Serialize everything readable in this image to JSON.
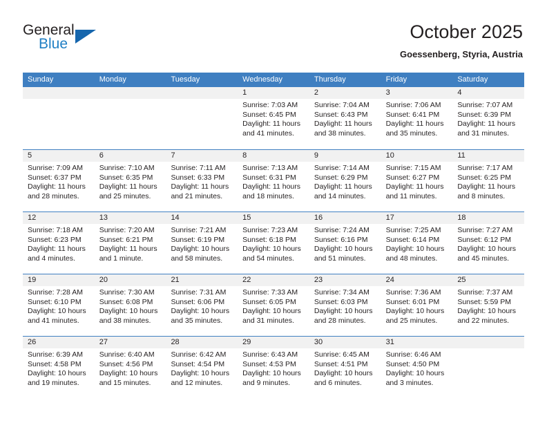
{
  "logo": {
    "primary_text": "General",
    "secondary_text": "Blue",
    "primary_color": "#231f20",
    "secondary_color": "#1f7fc4",
    "triangle_color": "#1666ad"
  },
  "header": {
    "title": "October 2025",
    "subtitle": "Goessenberg, Styria, Austria"
  },
  "theme": {
    "header_row_bg": "#3f7fc1",
    "header_row_text": "#ffffff",
    "date_band_bg": "#f1f1f1",
    "grid_line": "#3f7fc1",
    "body_text": "#231f20"
  },
  "weekdays": [
    "Sunday",
    "Monday",
    "Tuesday",
    "Wednesday",
    "Thursday",
    "Friday",
    "Saturday"
  ],
  "weeks": [
    [
      {
        "day": "",
        "sunrise": "",
        "sunset": "",
        "daylight_a": "",
        "daylight_b": "",
        "empty": true
      },
      {
        "day": "",
        "sunrise": "",
        "sunset": "",
        "daylight_a": "",
        "daylight_b": "",
        "empty": true
      },
      {
        "day": "",
        "sunrise": "",
        "sunset": "",
        "daylight_a": "",
        "daylight_b": "",
        "empty": true
      },
      {
        "day": "1",
        "sunrise": "Sunrise: 7:03 AM",
        "sunset": "Sunset: 6:45 PM",
        "daylight_a": "Daylight: 11 hours",
        "daylight_b": "and 41 minutes."
      },
      {
        "day": "2",
        "sunrise": "Sunrise: 7:04 AM",
        "sunset": "Sunset: 6:43 PM",
        "daylight_a": "Daylight: 11 hours",
        "daylight_b": "and 38 minutes."
      },
      {
        "day": "3",
        "sunrise": "Sunrise: 7:06 AM",
        "sunset": "Sunset: 6:41 PM",
        "daylight_a": "Daylight: 11 hours",
        "daylight_b": "and 35 minutes."
      },
      {
        "day": "4",
        "sunrise": "Sunrise: 7:07 AM",
        "sunset": "Sunset: 6:39 PM",
        "daylight_a": "Daylight: 11 hours",
        "daylight_b": "and 31 minutes."
      }
    ],
    [
      {
        "day": "5",
        "sunrise": "Sunrise: 7:09 AM",
        "sunset": "Sunset: 6:37 PM",
        "daylight_a": "Daylight: 11 hours",
        "daylight_b": "and 28 minutes."
      },
      {
        "day": "6",
        "sunrise": "Sunrise: 7:10 AM",
        "sunset": "Sunset: 6:35 PM",
        "daylight_a": "Daylight: 11 hours",
        "daylight_b": "and 25 minutes."
      },
      {
        "day": "7",
        "sunrise": "Sunrise: 7:11 AM",
        "sunset": "Sunset: 6:33 PM",
        "daylight_a": "Daylight: 11 hours",
        "daylight_b": "and 21 minutes."
      },
      {
        "day": "8",
        "sunrise": "Sunrise: 7:13 AM",
        "sunset": "Sunset: 6:31 PM",
        "daylight_a": "Daylight: 11 hours",
        "daylight_b": "and 18 minutes."
      },
      {
        "day": "9",
        "sunrise": "Sunrise: 7:14 AM",
        "sunset": "Sunset: 6:29 PM",
        "daylight_a": "Daylight: 11 hours",
        "daylight_b": "and 14 minutes."
      },
      {
        "day": "10",
        "sunrise": "Sunrise: 7:15 AM",
        "sunset": "Sunset: 6:27 PM",
        "daylight_a": "Daylight: 11 hours",
        "daylight_b": "and 11 minutes."
      },
      {
        "day": "11",
        "sunrise": "Sunrise: 7:17 AM",
        "sunset": "Sunset: 6:25 PM",
        "daylight_a": "Daylight: 11 hours",
        "daylight_b": "and 8 minutes."
      }
    ],
    [
      {
        "day": "12",
        "sunrise": "Sunrise: 7:18 AM",
        "sunset": "Sunset: 6:23 PM",
        "daylight_a": "Daylight: 11 hours",
        "daylight_b": "and 4 minutes."
      },
      {
        "day": "13",
        "sunrise": "Sunrise: 7:20 AM",
        "sunset": "Sunset: 6:21 PM",
        "daylight_a": "Daylight: 11 hours",
        "daylight_b": "and 1 minute."
      },
      {
        "day": "14",
        "sunrise": "Sunrise: 7:21 AM",
        "sunset": "Sunset: 6:19 PM",
        "daylight_a": "Daylight: 10 hours",
        "daylight_b": "and 58 minutes."
      },
      {
        "day": "15",
        "sunrise": "Sunrise: 7:23 AM",
        "sunset": "Sunset: 6:18 PM",
        "daylight_a": "Daylight: 10 hours",
        "daylight_b": "and 54 minutes."
      },
      {
        "day": "16",
        "sunrise": "Sunrise: 7:24 AM",
        "sunset": "Sunset: 6:16 PM",
        "daylight_a": "Daylight: 10 hours",
        "daylight_b": "and 51 minutes."
      },
      {
        "day": "17",
        "sunrise": "Sunrise: 7:25 AM",
        "sunset": "Sunset: 6:14 PM",
        "daylight_a": "Daylight: 10 hours",
        "daylight_b": "and 48 minutes."
      },
      {
        "day": "18",
        "sunrise": "Sunrise: 7:27 AM",
        "sunset": "Sunset: 6:12 PM",
        "daylight_a": "Daylight: 10 hours",
        "daylight_b": "and 45 minutes."
      }
    ],
    [
      {
        "day": "19",
        "sunrise": "Sunrise: 7:28 AM",
        "sunset": "Sunset: 6:10 PM",
        "daylight_a": "Daylight: 10 hours",
        "daylight_b": "and 41 minutes."
      },
      {
        "day": "20",
        "sunrise": "Sunrise: 7:30 AM",
        "sunset": "Sunset: 6:08 PM",
        "daylight_a": "Daylight: 10 hours",
        "daylight_b": "and 38 minutes."
      },
      {
        "day": "21",
        "sunrise": "Sunrise: 7:31 AM",
        "sunset": "Sunset: 6:06 PM",
        "daylight_a": "Daylight: 10 hours",
        "daylight_b": "and 35 minutes."
      },
      {
        "day": "22",
        "sunrise": "Sunrise: 7:33 AM",
        "sunset": "Sunset: 6:05 PM",
        "daylight_a": "Daylight: 10 hours",
        "daylight_b": "and 31 minutes."
      },
      {
        "day": "23",
        "sunrise": "Sunrise: 7:34 AM",
        "sunset": "Sunset: 6:03 PM",
        "daylight_a": "Daylight: 10 hours",
        "daylight_b": "and 28 minutes."
      },
      {
        "day": "24",
        "sunrise": "Sunrise: 7:36 AM",
        "sunset": "Sunset: 6:01 PM",
        "daylight_a": "Daylight: 10 hours",
        "daylight_b": "and 25 minutes."
      },
      {
        "day": "25",
        "sunrise": "Sunrise: 7:37 AM",
        "sunset": "Sunset: 5:59 PM",
        "daylight_a": "Daylight: 10 hours",
        "daylight_b": "and 22 minutes."
      }
    ],
    [
      {
        "day": "26",
        "sunrise": "Sunrise: 6:39 AM",
        "sunset": "Sunset: 4:58 PM",
        "daylight_a": "Daylight: 10 hours",
        "daylight_b": "and 19 minutes."
      },
      {
        "day": "27",
        "sunrise": "Sunrise: 6:40 AM",
        "sunset": "Sunset: 4:56 PM",
        "daylight_a": "Daylight: 10 hours",
        "daylight_b": "and 15 minutes."
      },
      {
        "day": "28",
        "sunrise": "Sunrise: 6:42 AM",
        "sunset": "Sunset: 4:54 PM",
        "daylight_a": "Daylight: 10 hours",
        "daylight_b": "and 12 minutes."
      },
      {
        "day": "29",
        "sunrise": "Sunrise: 6:43 AM",
        "sunset": "Sunset: 4:53 PM",
        "daylight_a": "Daylight: 10 hours",
        "daylight_b": "and 9 minutes."
      },
      {
        "day": "30",
        "sunrise": "Sunrise: 6:45 AM",
        "sunset": "Sunset: 4:51 PM",
        "daylight_a": "Daylight: 10 hours",
        "daylight_b": "and 6 minutes."
      },
      {
        "day": "31",
        "sunrise": "Sunrise: 6:46 AM",
        "sunset": "Sunset: 4:50 PM",
        "daylight_a": "Daylight: 10 hours",
        "daylight_b": "and 3 minutes."
      },
      {
        "day": "",
        "sunrise": "",
        "sunset": "",
        "daylight_a": "",
        "daylight_b": "",
        "empty": true
      }
    ]
  ]
}
